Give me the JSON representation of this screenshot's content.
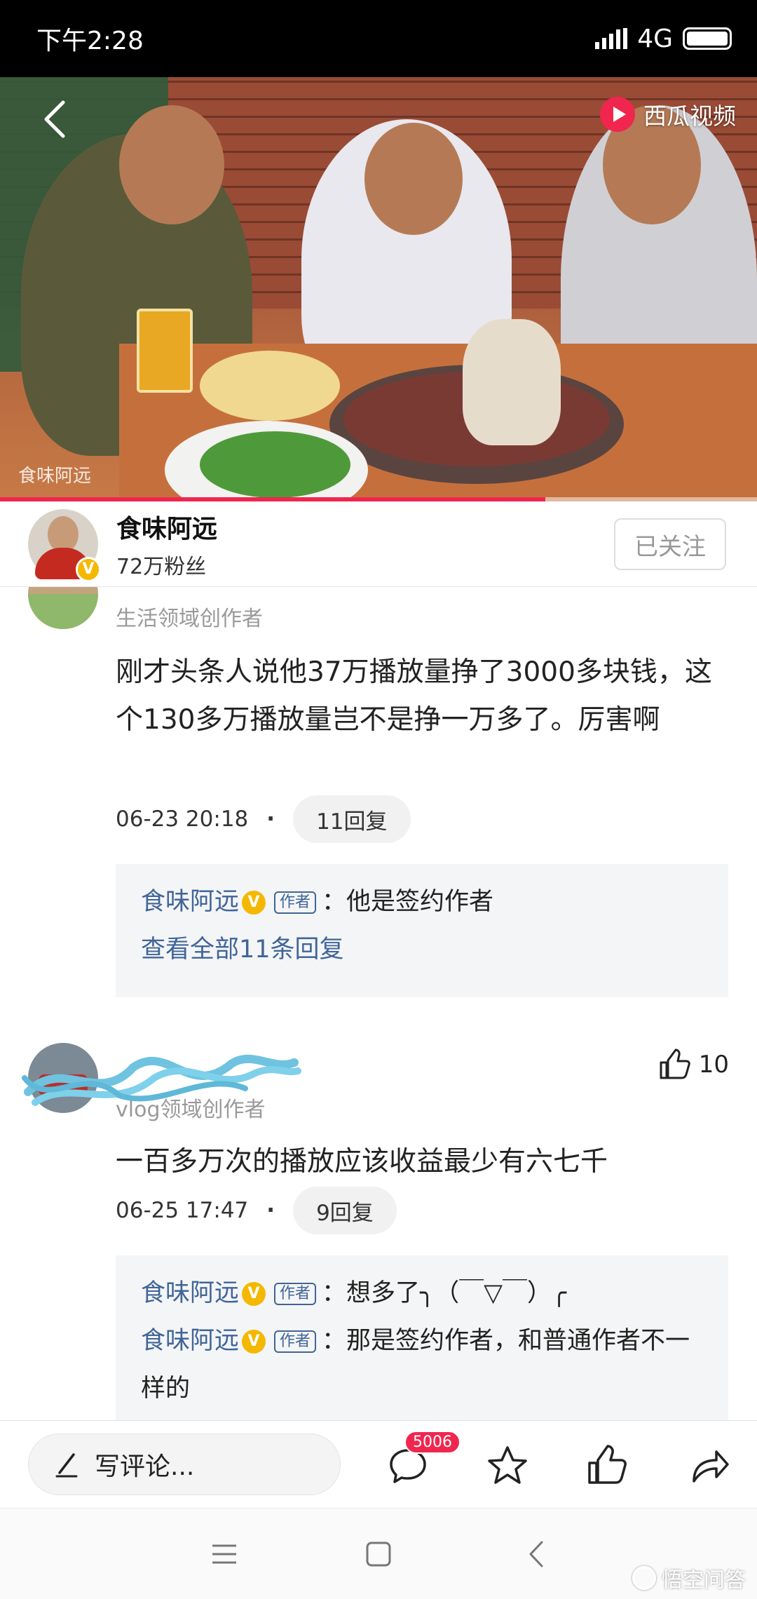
{
  "status_bar": {
    "time": "下午2:28",
    "network": "4G"
  },
  "video": {
    "brand": "西瓜视频",
    "watermark": "食味阿远",
    "progress_fraction": 0.72
  },
  "author": {
    "name": "食味阿远",
    "fans": "72万粉丝",
    "follow_label": "已关注",
    "verified_mark": "V"
  },
  "comments": [
    {
      "role": "生活领域创作者",
      "text": "刚才头条人说他37万播放量挣了3000多块钱，这个130多万播放量岂不是挣一万多了。厉害啊",
      "time": "06-23 20:18",
      "reply_count": "11回复",
      "replies": [
        {
          "name": "食味阿远",
          "tag": "作者",
          "text": "：他是签约作者"
        }
      ],
      "view_all": "查看全部11条回复"
    },
    {
      "role": "vlog领域创作者",
      "likes": "10",
      "text": "一百多万次的播放应该收益最少有六七千",
      "time": "06-25 17:47",
      "reply_count": "9回复",
      "replies": [
        {
          "name": "食味阿远",
          "tag": "作者",
          "text": "：想多了╮（￣▽￣）╭"
        },
        {
          "name": "食味阿远",
          "tag": "作者",
          "text": "：那是签约作者，和普通作者不一样的"
        }
      ]
    }
  ],
  "bottom_bar": {
    "write_placeholder": "写评论...",
    "comment_count": "5006"
  },
  "corner_watermark": "悟空问答",
  "colors": {
    "accent": "#f0264e",
    "link": "#406599",
    "verified": "#f5b800"
  }
}
